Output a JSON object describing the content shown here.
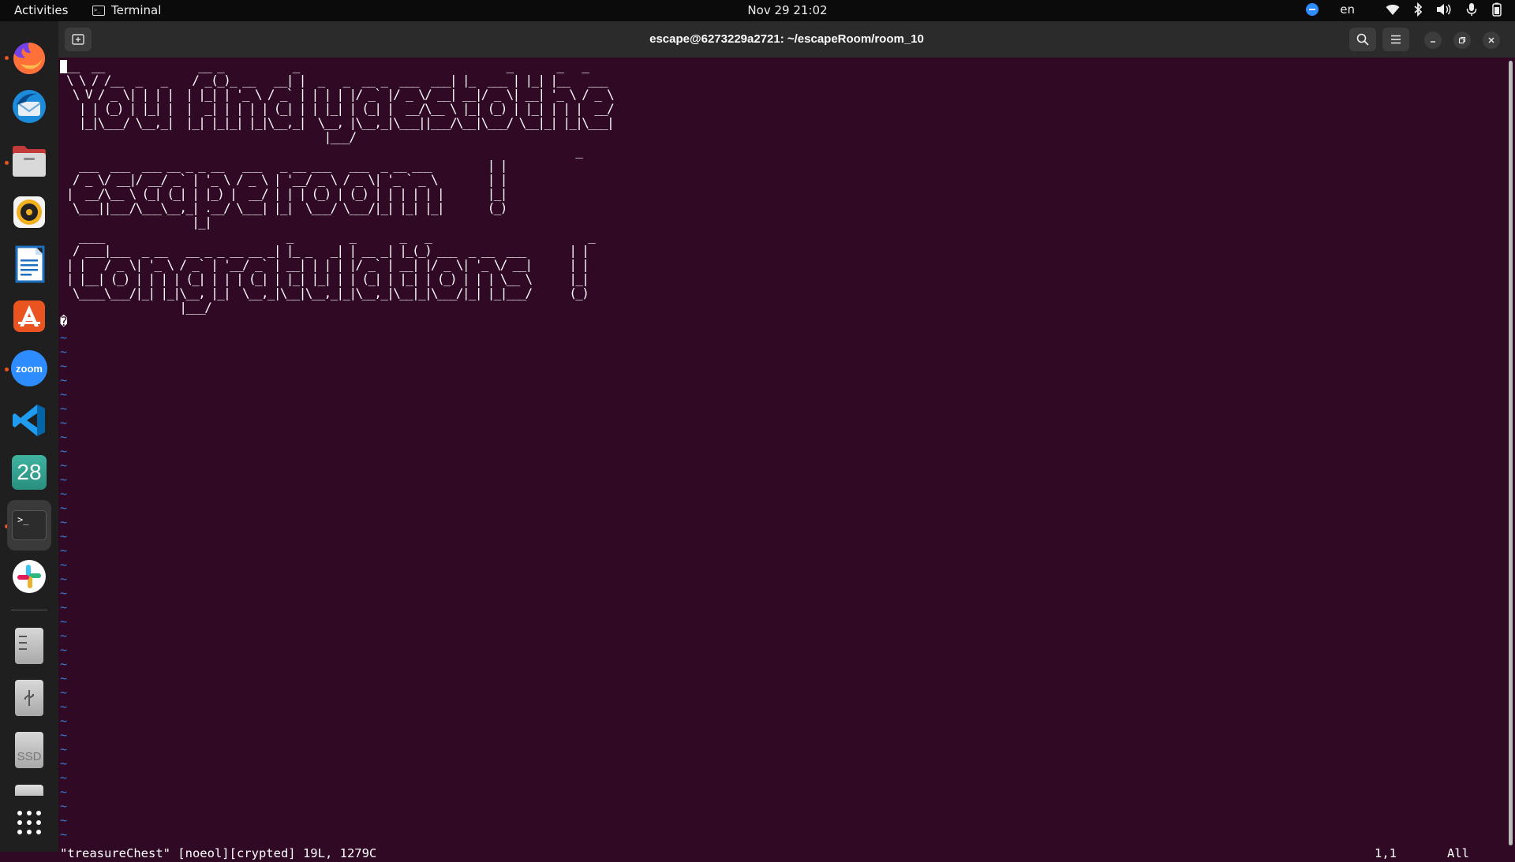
{
  "topbar": {
    "activities": "Activities",
    "app_name": "Terminal",
    "clock": "Nov 29  21:02",
    "language": "en",
    "tray_icons": [
      "zoom-icon",
      "wifi-icon",
      "bluetooth-icon",
      "volume-icon",
      "microphone-icon",
      "battery-icon"
    ]
  },
  "dock": {
    "items": [
      {
        "name": "firefox",
        "running": true
      },
      {
        "name": "thunderbird",
        "running": false
      },
      {
        "name": "files",
        "running": true
      },
      {
        "name": "rhythmbox",
        "running": false
      },
      {
        "name": "libreoffice-writer",
        "running": false
      },
      {
        "name": "app-center",
        "running": false
      },
      {
        "name": "zoom",
        "label": "zoom",
        "running": true
      },
      {
        "name": "vscode",
        "running": false
      },
      {
        "name": "calendar",
        "label": "28",
        "running": false
      },
      {
        "name": "terminal",
        "running": true,
        "active": true
      },
      {
        "name": "slack",
        "running": false
      },
      {
        "name": "file-manager-drive",
        "running": false
      },
      {
        "name": "usb-drive",
        "running": false
      },
      {
        "name": "ssd-drive",
        "label": "SSD",
        "running": false
      },
      {
        "name": "disk-drive",
        "running": false
      },
      {
        "name": "show-applications",
        "running": false
      }
    ]
  },
  "window": {
    "title": "escape@6273229a2721: ~/escapeRoom/room_10"
  },
  "terminal": {
    "ascii_art": " __  __               __ _           _                                 _       _   _\n \\ \\ / /__  _   _    / _(_)_ __   __| |  _   _  __ _  ___  ___| |_  ___ | |_| |__   ___\n  \\ V / _ \\| | | |  | |_| | '_ \\ / _` | | | | |/ _` |/ _ \\/ __| __|/ _ \\| __| '_ \\ / _ \\\n   | | (_) | |_| |  |  _| | | | | (_| | | |_| | (_| |  __/\\__ \\ |_| (_) | |_| | | |  __/\n   |_|\\___/ \\__,_|  |_| |_|_| |_|\\__,_|  \\__, |\\__,_|\\___||___/\\__|\\___/ \\__|_| |_|\\___|\n                                          |___/\n                                                                                  _\n   ___  ___  ___ __ _ _ __   ___   _ __ ___   ___  _ __ ___         | |\n  / _ \\/ __|/ __/ _` | '_ \\ / _ \\ | '__/ _ \\ / _ \\| '_ ` _ \\        | |\n |  __/\\__ \\ (_| (_| | |_) |  __/ | | | (_) | (_) | | | | | |       |_|\n  \\___||___/\\___\\__,_| .__/ \\___| |_|  \\___/ \\___/|_| |_| |_|       (_)\n                     |_|\n   ____                             _         _       _   _                         _\n  / ___|___  _ __   __ _ _ __ __ _| |_ _   _| | __ _| |_(_) ___  _ __  ___       | |\n | |   / _ \\| '_ \\ / _` | '__/ _` | __| | | | |/ _` | __| |/ _ \\| '_ \\/ __|      | |\n | |__| (_) | | | | (_| | | | (_| | |_| |_| | | (_| | |_| | (_) | | | \\__ \\      |_|\n  \\____\\___/|_| |_|\\__, |_|  \\__,_|\\__|\\__,_|_|\\__,_|\\__|_|\\___/|_| |_|___/      (_)\n                   |___/\n�",
    "tilde_count": 36,
    "status_message": "\"treasureChest\" [noeol][crypted] 19L, 1279C",
    "cursor_position": "1,1",
    "scroll_position": "All"
  },
  "colors": {
    "terminal_bg": "#300a24",
    "tilde": "#3d7dd8",
    "accent_running": "#e95420"
  }
}
